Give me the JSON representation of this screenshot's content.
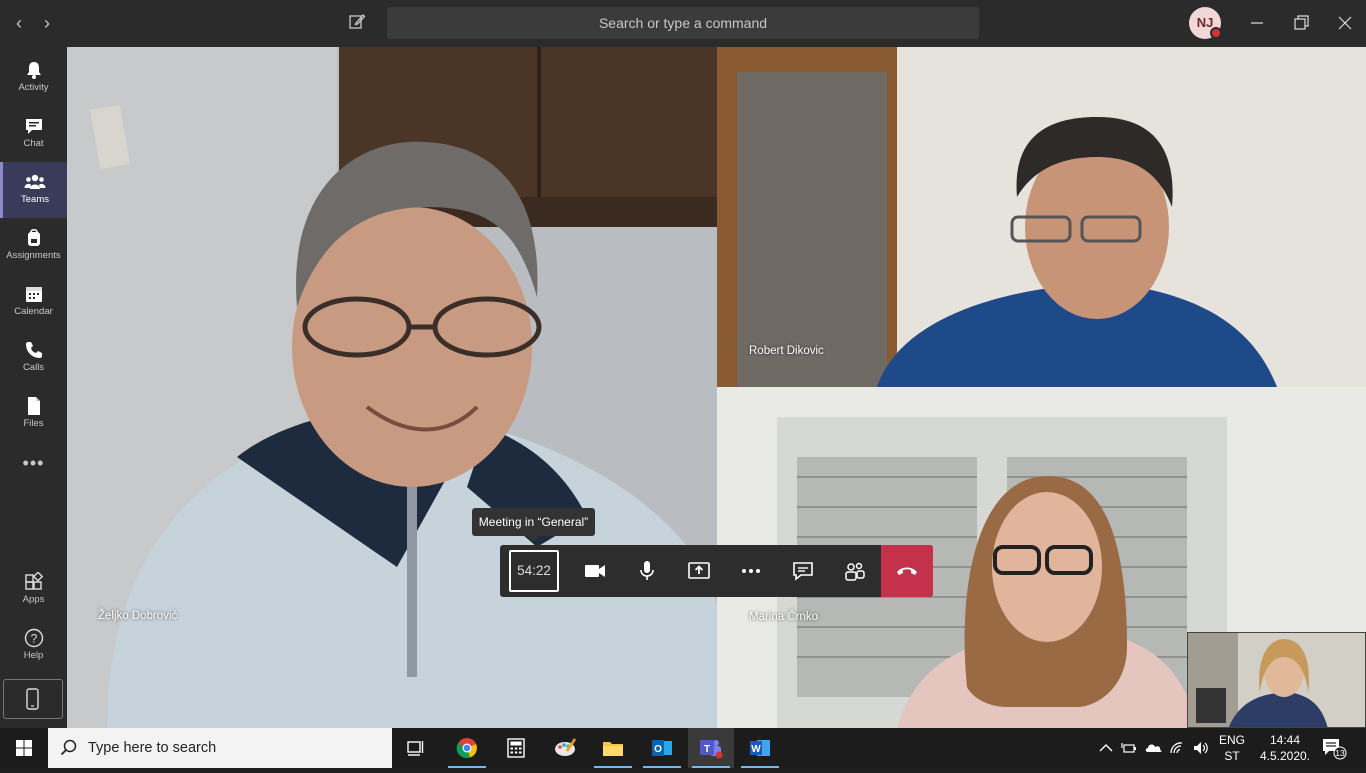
{
  "titlebar": {
    "back_label": "‹",
    "forward_label": "›",
    "search_placeholder": "Search or type a command",
    "avatar_initials": "NJ"
  },
  "rail": {
    "items": [
      {
        "label": "Activity",
        "icon": "bell-icon"
      },
      {
        "label": "Chat",
        "icon": "chat-icon"
      },
      {
        "label": "Teams",
        "icon": "teams-icon",
        "active": true
      },
      {
        "label": "Assignments",
        "icon": "backpack-icon"
      },
      {
        "label": "Calendar",
        "icon": "calendar-icon"
      },
      {
        "label": "Calls",
        "icon": "phone-icon"
      },
      {
        "label": "Files",
        "icon": "file-icon"
      }
    ],
    "more_label": "•••",
    "apps_label": "Apps",
    "help_label": "Help"
  },
  "participants": {
    "main": "Željko Dobrović",
    "top_right": "Robert Dikovic",
    "bottom_right": "Marina Črnko"
  },
  "call": {
    "tooltip": "Meeting in “General”",
    "timer": "54:22"
  },
  "taskbar": {
    "search_placeholder": "Type here to search",
    "lang_line1": "ENG",
    "lang_line2": "ST",
    "time": "14:44",
    "date": "4.5.2020.",
    "notification_count": "13"
  },
  "colors": {
    "accent": "#6264a7",
    "hangup": "#c4314b",
    "status_busy": "#d13438"
  }
}
